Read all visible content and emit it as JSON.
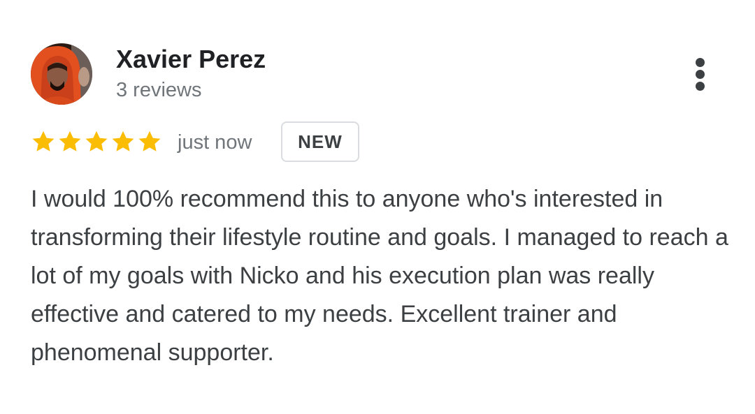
{
  "reviewer": {
    "name": "Xavier Perez",
    "review_count": "3 reviews",
    "avatar_icon": "avatar-photo"
  },
  "rating": {
    "stars": 5,
    "max_stars": 5,
    "star_color": "#fbbc04"
  },
  "time": "just now",
  "badge": "NEW",
  "review": {
    "text": "I would 100% recommend this to anyone who's interested in transforming their lifestyle routine and goals. I managed to reach a lot of my goals with Nicko and his execution plan was really effective and catered to my needs. Excellent trainer and phenomenal supporter."
  },
  "menu_icon": "more-vert-icon"
}
